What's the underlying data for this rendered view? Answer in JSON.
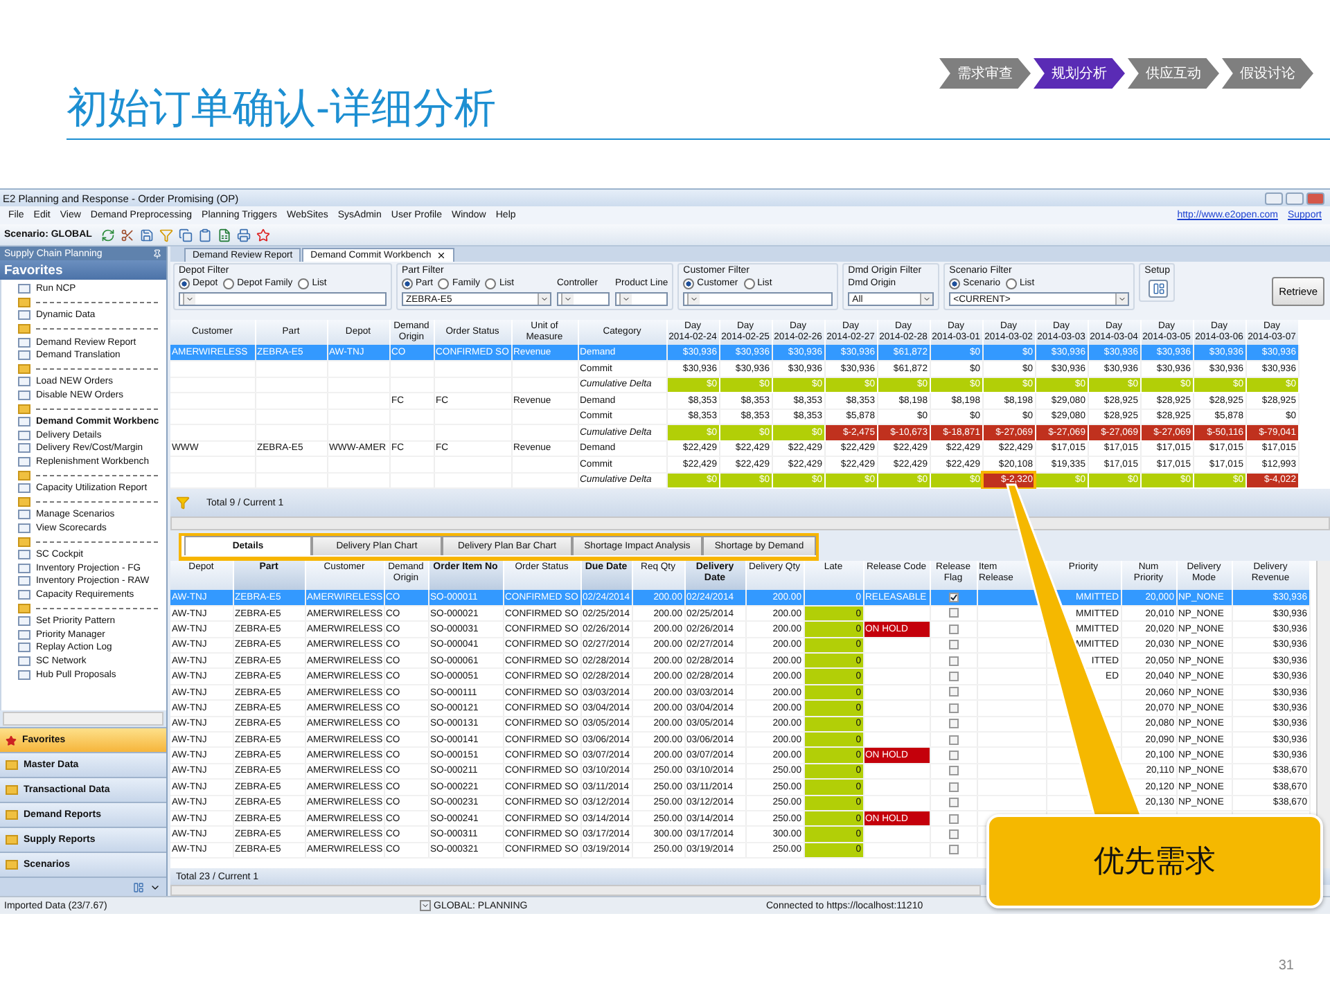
{
  "slide": {
    "title": "初始订单确认-详细分析",
    "steps": [
      {
        "label": "需求审查",
        "selected": false
      },
      {
        "label": "规划分析",
        "selected": true
      },
      {
        "label": "供应互动",
        "selected": false
      },
      {
        "label": "假设讨论",
        "selected": false
      }
    ],
    "page_number": "31",
    "callout": "优先需求"
  },
  "window": {
    "title": "E2 Planning and Response - Order Promising (OP)"
  },
  "menu": [
    "File",
    "Edit",
    "View",
    "Demand Preprocessing",
    "Planning Triggers",
    "WebSites",
    "SysAdmin",
    "User Profile",
    "Window",
    "Help"
  ],
  "links": [
    "http://www.e2open.com",
    "Support"
  ],
  "toolbar": {
    "scenario": "Scenario: GLOBAL"
  },
  "sidebar": {
    "header": "Supply Chain Planning",
    "section": "Favorites",
    "items": [
      {
        "kind": "item",
        "label": "Run NCP",
        "selected": false
      },
      {
        "kind": "separator"
      },
      {
        "kind": "item",
        "label": "Dynamic Data",
        "selected": false
      },
      {
        "kind": "separator"
      },
      {
        "kind": "item",
        "label": "Demand Review Report",
        "selected": false
      },
      {
        "kind": "item",
        "label": "Demand Translation",
        "selected": false
      },
      {
        "kind": "separator"
      },
      {
        "kind": "item",
        "label": "Load NEW Orders",
        "selected": false
      },
      {
        "kind": "item",
        "label": "Disable NEW Orders",
        "selected": false
      },
      {
        "kind": "separator"
      },
      {
        "kind": "item",
        "label": "Demand Commit Workbenc",
        "selected": true
      },
      {
        "kind": "item",
        "label": "Delivery Details",
        "selected": false
      },
      {
        "kind": "item",
        "label": "Delivery Rev/Cost/Margin",
        "selected": false
      },
      {
        "kind": "item",
        "label": "Replenishment Workbench",
        "selected": false
      },
      {
        "kind": "separator"
      },
      {
        "kind": "item",
        "label": "Capacity Utilization Report",
        "selected": false
      },
      {
        "kind": "separator"
      },
      {
        "kind": "item",
        "label": "Manage Scenarios",
        "selected": false
      },
      {
        "kind": "item",
        "label": "View Scorecards",
        "selected": false
      },
      {
        "kind": "separator"
      },
      {
        "kind": "item",
        "label": "SC Cockpit",
        "selected": false
      },
      {
        "kind": "item",
        "label": "Inventory Projection - FG",
        "selected": false
      },
      {
        "kind": "item",
        "label": "Inventory Projection - RAW",
        "selected": false
      },
      {
        "kind": "item",
        "label": "Capacity Requirements",
        "selected": false
      },
      {
        "kind": "separator"
      },
      {
        "kind": "item",
        "label": "Set Priority Pattern",
        "selected": false
      },
      {
        "kind": "item",
        "label": "Priority Manager",
        "selected": false
      },
      {
        "kind": "item",
        "label": "Replay Action Log",
        "selected": false
      },
      {
        "kind": "item",
        "label": "SC Network",
        "selected": false
      },
      {
        "kind": "item",
        "label": "Hub Pull Proposals",
        "selected": false
      }
    ],
    "nav": [
      {
        "label": "Favorites",
        "selected": true
      },
      {
        "label": "Master Data",
        "selected": false
      },
      {
        "label": "Transactional Data",
        "selected": false
      },
      {
        "label": "Demand Reports",
        "selected": false
      },
      {
        "label": "Supply Reports",
        "selected": false
      },
      {
        "label": "Scenarios",
        "selected": false
      }
    ]
  },
  "doc_tabs": [
    {
      "label": "Demand Review Report",
      "selected": false
    },
    {
      "label": "Demand Commit Workbench",
      "selected": true
    }
  ],
  "filters": [
    {
      "title": "Depot Filter",
      "options": [
        {
          "label": "Depot",
          "selected": true
        },
        {
          "label": "Depot Family",
          "selected": false
        },
        {
          "label": "List",
          "selected": false
        }
      ],
      "selects": [
        {
          "kind": "combo"
        }
      ]
    },
    {
      "title": "Part Filter",
      "options": [
        {
          "label": "Part",
          "selected": true
        },
        {
          "label": "Family",
          "selected": false
        },
        {
          "label": "List",
          "selected": false
        }
      ],
      "selects": [
        {
          "kind": "combo",
          "value": "ZEBRA-E5"
        },
        {
          "kind": "combo",
          "label": "Controller"
        },
        {
          "kind": "combo",
          "label": "Product Line"
        }
      ]
    },
    {
      "title": "Customer Filter",
      "options": [
        {
          "label": "Customer",
          "selected": true
        },
        {
          "label": "List",
          "selected": false
        }
      ],
      "selects": [
        {
          "kind": "combo"
        }
      ]
    },
    {
      "title": "Dmd Origin Filter",
      "selects": [
        {
          "kind": "combo",
          "label": "Dmd Origin",
          "value": "All"
        }
      ]
    },
    {
      "title": "Scenario Filter",
      "options": [
        {
          "label": "Scenario",
          "selected": true
        },
        {
          "label": "List",
          "selected": false
        }
      ],
      "selects": [
        {
          "kind": "combo",
          "value": "<CURRENT>"
        }
      ]
    }
  ],
  "setup": {
    "title": "Setup"
  },
  "retrieve": "Retrieve",
  "upper_grid": {
    "columns": [
      "Customer",
      "Part",
      "Depot",
      "Demand Origin",
      "Order Status",
      "Unit of Measure",
      "Category"
    ],
    "days": [
      {
        "day": "Day",
        "date": "2014-02-24"
      },
      {
        "day": "Day",
        "date": "2014-02-25"
      },
      {
        "day": "Day",
        "date": "2014-02-26"
      },
      {
        "day": "Day",
        "date": "2014-02-27"
      },
      {
        "day": "Day",
        "date": "2014-02-28"
      },
      {
        "day": "Day",
        "date": "2014-03-01"
      },
      {
        "day": "Day",
        "date": "2014-03-02"
      },
      {
        "day": "Day",
        "date": "2014-03-03"
      },
      {
        "day": "Day",
        "date": "2014-03-04"
      },
      {
        "day": "Day",
        "date": "2014-03-05"
      },
      {
        "day": "Day",
        "date": "2014-03-06"
      },
      {
        "day": "Day",
        "date": "2014-03-07"
      }
    ],
    "rows": [
      {
        "kind": "value",
        "selected": true,
        "customer": "AMERWIRELESS",
        "part": "ZEBRA-E5",
        "depot": "AW-TNJ",
        "demand_origin": "CO",
        "order_status": "CONFIRMED SO",
        "unit": "Revenue",
        "category": "Demand",
        "values": [
          "$30,936",
          "$30,936",
          "$30,936",
          "$30,936",
          "$61,872",
          "$0",
          "$0",
          "$30,936",
          "$30,936",
          "$30,936",
          "$30,936",
          "$30,936"
        ]
      },
      {
        "kind": "value",
        "selected": false,
        "category": "Commit",
        "values": [
          "$30,936",
          "$30,936",
          "$30,936",
          "$30,936",
          "$61,872",
          "$0",
          "$0",
          "$30,936",
          "$30,936",
          "$30,936",
          "$30,936",
          "$30,936"
        ]
      },
      {
        "kind": "delta",
        "selected": false,
        "category": "Cumulative Delta",
        "values": [
          {
            "v": "$0",
            "short": false,
            "flagged": false
          },
          {
            "v": "$0",
            "short": false,
            "flagged": false
          },
          {
            "v": "$0",
            "short": false,
            "flagged": false
          },
          {
            "v": "$0",
            "short": false,
            "flagged": false
          },
          {
            "v": "$0",
            "short": false,
            "flagged": false
          },
          {
            "v": "$0",
            "short": false,
            "flagged": false
          },
          {
            "v": "$0",
            "short": false,
            "flagged": false
          },
          {
            "v": "$0",
            "short": false,
            "flagged": false
          },
          {
            "v": "$0",
            "short": false,
            "flagged": false
          },
          {
            "v": "$0",
            "short": false,
            "flagged": false
          },
          {
            "v": "$0",
            "short": false,
            "flagged": false
          },
          {
            "v": "$0",
            "short": false,
            "flagged": false
          }
        ]
      },
      {
        "kind": "value",
        "selected": false,
        "demand_origin": "FC",
        "order_status": "FC",
        "unit": "Revenue",
        "category": "Demand",
        "values": [
          "$8,353",
          "$8,353",
          "$8,353",
          "$8,353",
          "$8,198",
          "$8,198",
          "$8,198",
          "$29,080",
          "$28,925",
          "$28,925",
          "$28,925",
          "$28,925"
        ]
      },
      {
        "kind": "value",
        "selected": false,
        "category": "Commit",
        "values": [
          "$8,353",
          "$8,353",
          "$8,353",
          "$5,878",
          "$0",
          "$0",
          "$0",
          "$29,080",
          "$28,925",
          "$28,925",
          "$5,878",
          "$0"
        ]
      },
      {
        "kind": "delta",
        "selected": false,
        "category": "Cumulative Delta",
        "values": [
          {
            "v": "$0",
            "short": false,
            "flagged": false
          },
          {
            "v": "$0",
            "short": false,
            "flagged": false
          },
          {
            "v": "$0",
            "short": false,
            "flagged": false
          },
          {
            "v": "$-2,475",
            "short": true,
            "flagged": false
          },
          {
            "v": "$-10,673",
            "short": true,
            "flagged": false
          },
          {
            "v": "$-18,871",
            "short": true,
            "flagged": false
          },
          {
            "v": "$-27,069",
            "short": true,
            "flagged": false
          },
          {
            "v": "$-27,069",
            "short": true,
            "flagged": false
          },
          {
            "v": "$-27,069",
            "short": true,
            "flagged": false
          },
          {
            "v": "$-27,069",
            "short": true,
            "flagged": false
          },
          {
            "v": "$-50,116",
            "short": true,
            "flagged": false
          },
          {
            "v": "$-79,041",
            "short": true,
            "flagged": false
          }
        ]
      },
      {
        "kind": "value",
        "selected": false,
        "customer": "WWW",
        "part": "ZEBRA-E5",
        "depot": "WWW-AMER",
        "demand_origin": "FC",
        "order_status": "FC",
        "unit": "Revenue",
        "category": "Demand",
        "values": [
          "$22,429",
          "$22,429",
          "$22,429",
          "$22,429",
          "$22,429",
          "$22,429",
          "$22,429",
          "$17,015",
          "$17,015",
          "$17,015",
          "$17,015",
          "$17,015"
        ]
      },
      {
        "kind": "value",
        "selected": false,
        "category": "Commit",
        "values": [
          "$22,429",
          "$22,429",
          "$22,429",
          "$22,429",
          "$22,429",
          "$22,429",
          "$20,108",
          "$19,335",
          "$17,015",
          "$17,015",
          "$17,015",
          "$12,993"
        ]
      },
      {
        "kind": "delta",
        "selected": false,
        "category": "Cumulative Delta",
        "values": [
          {
            "v": "$0",
            "short": false,
            "flagged": false
          },
          {
            "v": "$0",
            "short": false,
            "flagged": false
          },
          {
            "v": "$0",
            "short": false,
            "flagged": false
          },
          {
            "v": "$0",
            "short": false,
            "flagged": false
          },
          {
            "v": "$0",
            "short": false,
            "flagged": false
          },
          {
            "v": "$0",
            "short": false,
            "flagged": false
          },
          {
            "v": "$-2,320",
            "short": true,
            "flagged": true
          },
          {
            "v": "$0",
            "short": false,
            "flagged": false
          },
          {
            "v": "$0",
            "short": false,
            "flagged": false
          },
          {
            "v": "$0",
            "short": false,
            "flagged": false
          },
          {
            "v": "$0",
            "short": false,
            "flagged": false
          },
          {
            "v": "$-4,022",
            "short": true,
            "flagged": false
          }
        ]
      }
    ],
    "total": "Total 9 / Current 1"
  },
  "detail_tabs": [
    {
      "label": "Details",
      "selected": true
    },
    {
      "label": "Delivery Plan Chart",
      "selected": false
    },
    {
      "label": "Delivery Plan Bar Chart",
      "selected": false
    },
    {
      "label": "Shortage Impact Analysis",
      "selected": false
    },
    {
      "label": "Shortage by Demand",
      "selected": false
    }
  ],
  "detail_grid": {
    "columns": [
      {
        "label": "Depot",
        "sorted": false
      },
      {
        "label": "Part",
        "sorted": true
      },
      {
        "label": "Customer",
        "sorted": false
      },
      {
        "label": "Demand Origin",
        "sorted": false
      },
      {
        "label": "Order Item No",
        "sorted": true
      },
      {
        "label": "Order Status",
        "sorted": false
      },
      {
        "label": "Due Date",
        "sorted": true
      },
      {
        "label": "Req Qty",
        "sorted": false
      },
      {
        "label": "Delivery Date",
        "sorted": true
      },
      {
        "label": "Delivery Qty",
        "sorted": false
      },
      {
        "label": "Late",
        "sorted": false
      },
      {
        "label": "Release Code",
        "sorted": false
      },
      {
        "label": "Release Flag",
        "sorted": false
      },
      {
        "label": "Item Release",
        "sorted": false
      },
      {
        "label": "Priority",
        "sorted": false
      },
      {
        "label": "Num Priority",
        "sorted": false
      },
      {
        "label": "Delivery Mode",
        "sorted": false
      },
      {
        "label": "Delivery Revenue",
        "sorted": false
      }
    ],
    "rows": [
      {
        "selected": true,
        "depot": "AW-TNJ",
        "part": "ZEBRA-E5",
        "customer": "AMERWIRELESS",
        "demand_origin": "CO",
        "order_item": "SO-000011",
        "order_status": "CONFIRMED SO",
        "due_date": "02/24/2014",
        "req_qty": "200.00",
        "delivery_date": "02/24/2014",
        "delivery_qty": "200.00",
        "late": "0",
        "late_ok": false,
        "release_code": "RELEASABLE",
        "hold": false,
        "release_flag": true,
        "priority": "MMITTED",
        "num_priority": "20,000",
        "delivery_mode": "NP_NONE",
        "revenue": "$30,936"
      },
      {
        "selected": false,
        "depot": "AW-TNJ",
        "part": "ZEBRA-E5",
        "customer": "AMERWIRELESS",
        "demand_origin": "CO",
        "order_item": "SO-000021",
        "order_status": "CONFIRMED SO",
        "due_date": "02/25/2014",
        "req_qty": "200.00",
        "delivery_date": "02/25/2014",
        "delivery_qty": "200.00",
        "late": "0",
        "late_ok": true,
        "hold": false,
        "release_flag": false,
        "priority": "MMITTED",
        "num_priority": "20,010",
        "delivery_mode": "NP_NONE",
        "revenue": "$30,936"
      },
      {
        "selected": false,
        "depot": "AW-TNJ",
        "part": "ZEBRA-E5",
        "customer": "AMERWIRELESS",
        "demand_origin": "CO",
        "order_item": "SO-000031",
        "order_status": "CONFIRMED SO",
        "due_date": "02/26/2014",
        "req_qty": "200.00",
        "delivery_date": "02/26/2014",
        "delivery_qty": "200.00",
        "late": "0",
        "late_ok": true,
        "release_code": "ON HOLD",
        "hold": true,
        "release_flag": false,
        "priority": "MMITTED",
        "num_priority": "20,020",
        "delivery_mode": "NP_NONE",
        "revenue": "$30,936"
      },
      {
        "selected": false,
        "depot": "AW-TNJ",
        "part": "ZEBRA-E5",
        "customer": "AMERWIRELESS",
        "demand_origin": "CO",
        "order_item": "SO-000041",
        "order_status": "CONFIRMED SO",
        "due_date": "02/27/2014",
        "req_qty": "200.00",
        "delivery_date": "02/27/2014",
        "delivery_qty": "200.00",
        "late": "0",
        "late_ok": true,
        "hold": false,
        "release_flag": false,
        "priority": "MMITTED",
        "num_priority": "20,030",
        "delivery_mode": "NP_NONE",
        "revenue": "$30,936"
      },
      {
        "selected": false,
        "depot": "AW-TNJ",
        "part": "ZEBRA-E5",
        "customer": "AMERWIRELESS",
        "demand_origin": "CO",
        "order_item": "SO-000061",
        "order_status": "CONFIRMED SO",
        "due_date": "02/28/2014",
        "req_qty": "200.00",
        "delivery_date": "02/28/2014",
        "delivery_qty": "200.00",
        "late": "0",
        "late_ok": true,
        "hold": false,
        "release_flag": false,
        "priority": "ITTED",
        "num_priority": "20,050",
        "delivery_mode": "NP_NONE",
        "revenue": "$30,936"
      },
      {
        "selected": false,
        "depot": "AW-TNJ",
        "part": "ZEBRA-E5",
        "customer": "AMERWIRELESS",
        "demand_origin": "CO",
        "order_item": "SO-000051",
        "order_status": "CONFIRMED SO",
        "due_date": "02/28/2014",
        "req_qty": "200.00",
        "delivery_date": "02/28/2014",
        "delivery_qty": "200.00",
        "late": "0",
        "late_ok": true,
        "hold": false,
        "release_flag": false,
        "priority": "ED",
        "num_priority": "20,040",
        "delivery_mode": "NP_NONE",
        "revenue": "$30,936"
      },
      {
        "selected": false,
        "depot": "AW-TNJ",
        "part": "ZEBRA-E5",
        "customer": "AMERWIRELESS",
        "demand_origin": "CO",
        "order_item": "SO-000111",
        "order_status": "CONFIRMED SO",
        "due_date": "03/03/2014",
        "req_qty": "200.00",
        "delivery_date": "03/03/2014",
        "delivery_qty": "200.00",
        "late": "0",
        "late_ok": true,
        "hold": false,
        "release_flag": false,
        "num_priority": "20,060",
        "delivery_mode": "NP_NONE",
        "revenue": "$30,936"
      },
      {
        "selected": false,
        "depot": "AW-TNJ",
        "part": "ZEBRA-E5",
        "customer": "AMERWIRELESS",
        "demand_origin": "CO",
        "order_item": "SO-000121",
        "order_status": "CONFIRMED SO",
        "due_date": "03/04/2014",
        "req_qty": "200.00",
        "delivery_date": "03/04/2014",
        "delivery_qty": "200.00",
        "late": "0",
        "late_ok": true,
        "hold": false,
        "release_flag": false,
        "num_priority": "20,070",
        "delivery_mode": "NP_NONE",
        "revenue": "$30,936"
      },
      {
        "selected": false,
        "depot": "AW-TNJ",
        "part": "ZEBRA-E5",
        "customer": "AMERWIRELESS",
        "demand_origin": "CO",
        "order_item": "SO-000131",
        "order_status": "CONFIRMED SO",
        "due_date": "03/05/2014",
        "req_qty": "200.00",
        "delivery_date": "03/05/2014",
        "delivery_qty": "200.00",
        "late": "0",
        "late_ok": true,
        "hold": false,
        "release_flag": false,
        "num_priority": "20,080",
        "delivery_mode": "NP_NONE",
        "revenue": "$30,936"
      },
      {
        "selected": false,
        "depot": "AW-TNJ",
        "part": "ZEBRA-E5",
        "customer": "AMERWIRELESS",
        "demand_origin": "CO",
        "order_item": "SO-000141",
        "order_status": "CONFIRMED SO",
        "due_date": "03/06/2014",
        "req_qty": "200.00",
        "delivery_date": "03/06/2014",
        "delivery_qty": "200.00",
        "late": "0",
        "late_ok": true,
        "hold": false,
        "release_flag": false,
        "num_priority": "20,090",
        "delivery_mode": "NP_NONE",
        "revenue": "$30,936"
      },
      {
        "selected": false,
        "depot": "AW-TNJ",
        "part": "ZEBRA-E5",
        "customer": "AMERWIRELESS",
        "demand_origin": "CO",
        "order_item": "SO-000151",
        "order_status": "CONFIRMED SO",
        "due_date": "03/07/2014",
        "req_qty": "200.00",
        "delivery_date": "03/07/2014",
        "delivery_qty": "200.00",
        "late": "0",
        "late_ok": true,
        "release_code": "ON HOLD",
        "hold": true,
        "release_flag": false,
        "num_priority": "20,100",
        "delivery_mode": "NP_NONE",
        "revenue": "$30,936"
      },
      {
        "selected": false,
        "depot": "AW-TNJ",
        "part": "ZEBRA-E5",
        "customer": "AMERWIRELESS",
        "demand_origin": "CO",
        "order_item": "SO-000211",
        "order_status": "CONFIRMED SO",
        "due_date": "03/10/2014",
        "req_qty": "250.00",
        "delivery_date": "03/10/2014",
        "delivery_qty": "250.00",
        "late": "0",
        "late_ok": true,
        "hold": false,
        "release_flag": false,
        "num_priority": "20,110",
        "delivery_mode": "NP_NONE",
        "revenue": "$38,670"
      },
      {
        "selected": false,
        "depot": "AW-TNJ",
        "part": "ZEBRA-E5",
        "customer": "AMERWIRELESS",
        "demand_origin": "CO",
        "order_item": "SO-000221",
        "order_status": "CONFIRMED SO",
        "due_date": "03/11/2014",
        "req_qty": "250.00",
        "delivery_date": "03/11/2014",
        "delivery_qty": "250.00",
        "late": "0",
        "late_ok": true,
        "hold": false,
        "release_flag": false,
        "num_priority": "20,120",
        "delivery_mode": "NP_NONE",
        "revenue": "$38,670"
      },
      {
        "selected": false,
        "depot": "AW-TNJ",
        "part": "ZEBRA-E5",
        "customer": "AMERWIRELESS",
        "demand_origin": "CO",
        "order_item": "SO-000231",
        "order_status": "CONFIRMED SO",
        "due_date": "03/12/2014",
        "req_qty": "250.00",
        "delivery_date": "03/12/2014",
        "delivery_qty": "250.00",
        "late": "0",
        "late_ok": true,
        "hold": false,
        "release_flag": false,
        "num_priority": "20,130",
        "delivery_mode": "NP_NONE",
        "revenue": "$38,670"
      },
      {
        "selected": false,
        "depot": "AW-TNJ",
        "part": "ZEBRA-E5",
        "customer": "AMERWIRELESS",
        "demand_origin": "CO",
        "order_item": "SO-000241",
        "order_status": "CONFIRMED SO",
        "due_date": "03/14/2014",
        "req_qty": "250.00",
        "delivery_date": "03/14/2014",
        "delivery_qty": "250.00",
        "late": "0",
        "late_ok": true,
        "release_code": "ON HOLD",
        "hold": true,
        "release_flag": false
      },
      {
        "selected": false,
        "depot": "AW-TNJ",
        "part": "ZEBRA-E5",
        "customer": "AMERWIRELESS",
        "demand_origin": "CO",
        "order_item": "SO-000311",
        "order_status": "CONFIRMED SO",
        "due_date": "03/17/2014",
        "req_qty": "300.00",
        "delivery_date": "03/17/2014",
        "delivery_qty": "300.00",
        "late": "0",
        "late_ok": true,
        "hold": false,
        "release_flag": false
      },
      {
        "selected": false,
        "depot": "AW-TNJ",
        "part": "ZEBRA-E5",
        "customer": "AMERWIRELESS",
        "demand_origin": "CO",
        "order_item": "SO-000321",
        "order_status": "CONFIRMED SO",
        "due_date": "03/19/2014",
        "req_qty": "250.00",
        "delivery_date": "03/19/2014",
        "delivery_qty": "250.00",
        "late": "0",
        "late_ok": true,
        "hold": false,
        "release_flag": false
      }
    ],
    "total": "Total 23 / Current 1"
  },
  "status_bar": {
    "left": "Imported Data (23/7.67)",
    "center": "GLOBAL: PLANNING",
    "right": "Connected to https://localhost:11210"
  }
}
